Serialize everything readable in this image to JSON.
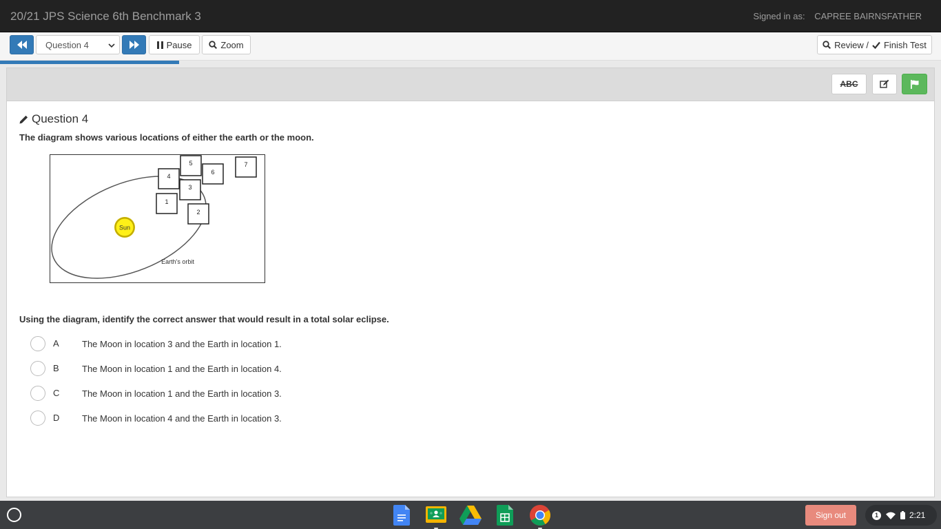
{
  "header": {
    "title": "20/21 JPS Science 6th Benchmark 3",
    "signed_in_label": "Signed in as:",
    "user_name": "CAPREE BAIRNSFATHER"
  },
  "toolbar": {
    "question_select_value": "Question 4",
    "pause_label": "Pause",
    "zoom_label": "Zoom",
    "review_label": "Review /",
    "finish_label": "Finish Test"
  },
  "progress": {
    "percent": 19
  },
  "tools": {
    "abc_label": "ABC"
  },
  "question": {
    "title": "Question 4",
    "prompt": "The diagram shows various locations of either the earth or the moon.",
    "diagram": {
      "sun_label": "Sun",
      "orbit_label": "Earth's orbit",
      "boxes": [
        "1",
        "2",
        "3",
        "4",
        "5",
        "6",
        "7"
      ]
    },
    "ask": "Using the diagram, identify the correct answer that would result in a total solar eclipse.",
    "choices": [
      {
        "letter": "A",
        "text": "The Moon in location 3 and the Earth in location 1."
      },
      {
        "letter": "B",
        "text": "The Moon in location 1 and the Earth in location 4."
      },
      {
        "letter": "C",
        "text": "The Moon in location 1 and the Earth in location 3."
      },
      {
        "letter": "D",
        "text": "The Moon in location 4 and the Earth in location 3."
      }
    ]
  },
  "shelf": {
    "apps": [
      "docs-icon",
      "classroom-icon",
      "drive-icon",
      "sheets-icon",
      "chrome-icon"
    ],
    "signout_label": "Sign out",
    "notification_count": "1",
    "time": "2:21"
  },
  "colors": {
    "primary": "#337ab7",
    "flag_green": "#5cb85c",
    "signout": "#e88a7d",
    "header_bg": "#222222"
  }
}
